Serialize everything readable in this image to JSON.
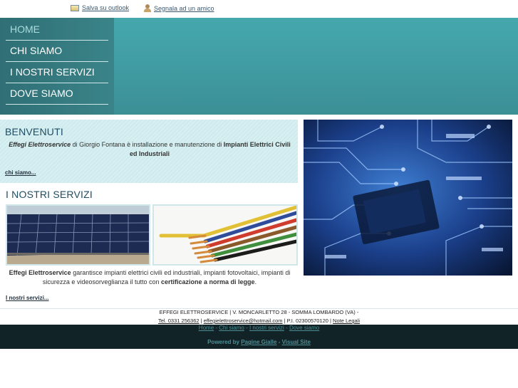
{
  "topbar": {
    "outlook_label": "Salva su outlook",
    "friend_label": "Segnala ad un amico",
    "outlook_icon": "outlook-icon",
    "friend_icon": "friend-icon"
  },
  "nav": {
    "items": [
      {
        "label": "HOME",
        "active": true
      },
      {
        "label": "CHI SIAMO"
      },
      {
        "label": "I NOSTRI SERVIZI"
      },
      {
        "label": "DOVE SIAMO"
      }
    ]
  },
  "welcome": {
    "title": "BENVENUTI",
    "company": "Effegi Elettroservice",
    "text1": " di Giorgio Fontana è installazione e manutenzione di ",
    "bold": "Impianti Elettrici Civili ed Industriali",
    "more_link": "chi siamo..."
  },
  "services": {
    "title": "I NOSTRI SERVIZI",
    "company": "Effegi Elettroservice",
    "text1": " garantisce impianti elettrici civili ed industriali, impianti fotovoltaici, impianti di sicurezza e videosorveglianza il tutto con ",
    "bold": "certificazione a norma di legge",
    "text2": ".",
    "more_link": "I nostri servizi..."
  },
  "footer": {
    "line1": "EFFEGI ELETTROSERVICE | V. MONCARLETTO 28 - SOMMA LOMBARDO (VA) -",
    "tel": "Tel. 0331 256362",
    "sep1": " | ",
    "email": "effegielettroservice@hotmail.com",
    "piva": " | P.I. 02300570120 | ",
    "legal": "Note Legali",
    "links": [
      "Home",
      "Chi siamo",
      "I nostri servizi",
      "Dove siamo"
    ],
    "link_sep": " - ",
    "powered_prefix": "Powered by ",
    "powered_1": "Pagine Gialle",
    "powered_sep": " - ",
    "powered_2": "Visual Site"
  },
  "colors": {
    "header_teal": "#45a8ad",
    "nav_dark": "#2f6f75",
    "title_blue": "#1f4d63",
    "footer_dark": "#112327"
  }
}
